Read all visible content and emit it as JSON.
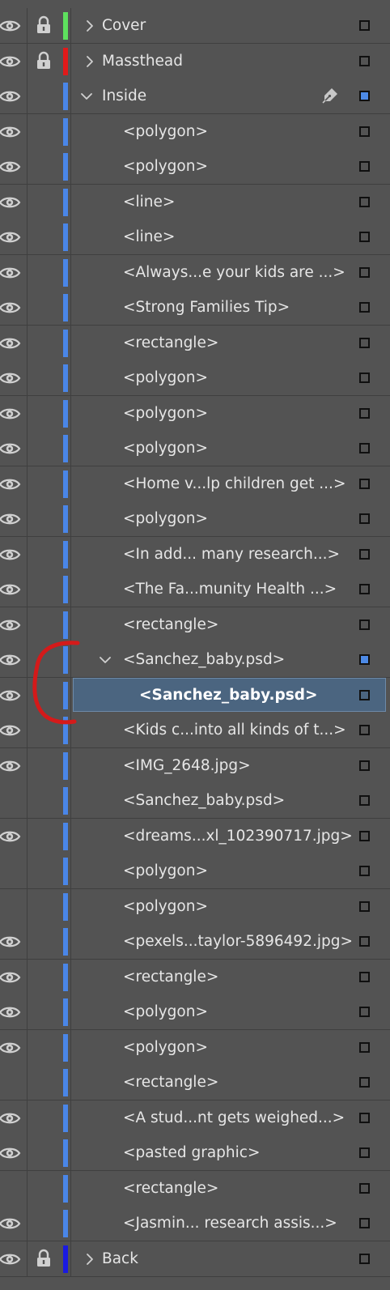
{
  "colors": {
    "panel_bg": "#535353",
    "divider": "#3f3f3f",
    "selected_row": "#4b6580",
    "selection_square": "#4d8ae6",
    "annotation": "#d41a1a"
  },
  "layers": [
    {
      "name": "Cover",
      "type": "layer",
      "depth": 0,
      "expandable": true,
      "expanded": false,
      "visible": true,
      "locked": true,
      "color": "#5ee05e",
      "target_selected": false
    },
    {
      "name": "Massthead",
      "type": "layer",
      "depth": 0,
      "expandable": true,
      "expanded": false,
      "visible": true,
      "locked": true,
      "color": "#e01a1a",
      "target_selected": false
    },
    {
      "name": "Inside",
      "type": "layer",
      "depth": 0,
      "expandable": true,
      "expanded": true,
      "visible": true,
      "locked": false,
      "color": "#4a86e8",
      "target_selected": true,
      "pen": true
    },
    {
      "name": "<polygon>",
      "type": "object",
      "depth": 1,
      "visible": true,
      "locked": false,
      "color": "#4a86e8"
    },
    {
      "name": "<polygon>",
      "type": "object",
      "depth": 1,
      "visible": true,
      "locked": false,
      "color": "#4a86e8"
    },
    {
      "name": "<line>",
      "type": "object",
      "depth": 1,
      "visible": true,
      "locked": false,
      "color": "#4a86e8"
    },
    {
      "name": "<line>",
      "type": "object",
      "depth": 1,
      "visible": true,
      "locked": false,
      "color": "#4a86e8"
    },
    {
      "name": "<Always...e your kids are ...>",
      "type": "object",
      "depth": 1,
      "visible": true,
      "locked": false,
      "color": "#4a86e8"
    },
    {
      "name": "<Strong Families Tip>",
      "type": "object",
      "depth": 1,
      "visible": true,
      "locked": false,
      "color": "#4a86e8"
    },
    {
      "name": "<rectangle>",
      "type": "object",
      "depth": 1,
      "visible": true,
      "locked": false,
      "color": "#4a86e8"
    },
    {
      "name": "<polygon>",
      "type": "object",
      "depth": 1,
      "visible": true,
      "locked": false,
      "color": "#4a86e8"
    },
    {
      "name": "<polygon>",
      "type": "object",
      "depth": 1,
      "visible": true,
      "locked": false,
      "color": "#4a86e8"
    },
    {
      "name": "<polygon>",
      "type": "object",
      "depth": 1,
      "visible": true,
      "locked": false,
      "color": "#4a86e8"
    },
    {
      "name": "<Home v...lp children get ...>",
      "type": "object",
      "depth": 1,
      "visible": true,
      "locked": false,
      "color": "#4a86e8"
    },
    {
      "name": "<polygon>",
      "type": "object",
      "depth": 1,
      "visible": true,
      "locked": false,
      "color": "#4a86e8"
    },
    {
      "name": "<In add... many research...>",
      "type": "object",
      "depth": 1,
      "visible": true,
      "locked": false,
      "color": "#4a86e8"
    },
    {
      "name": "<The Fa...munity Health ...>",
      "type": "object",
      "depth": 1,
      "visible": true,
      "locked": false,
      "color": "#4a86e8"
    },
    {
      "name": "<rectangle>",
      "type": "object",
      "depth": 1,
      "visible": true,
      "locked": false,
      "color": "#4a86e8"
    },
    {
      "name": "<Sanchez_baby.psd>",
      "type": "group",
      "depth": 1,
      "expandable": true,
      "expanded": true,
      "visible": true,
      "locked": false,
      "color": "#4a86e8",
      "target_selected": true
    },
    {
      "name": "<Sanchez_baby.psd>",
      "type": "object",
      "depth": 2,
      "visible": true,
      "locked": false,
      "color": "#4a86e8",
      "selected": true
    },
    {
      "name": "<Kids c...into all kinds of t...>",
      "type": "object",
      "depth": 1,
      "visible": true,
      "locked": false,
      "color": "#4a86e8"
    },
    {
      "name": "<IMG_2648.jpg>",
      "type": "object",
      "depth": 1,
      "visible": true,
      "locked": false,
      "color": "#4a86e8"
    },
    {
      "name": "<Sanchez_baby.psd>",
      "type": "object",
      "depth": 1,
      "visible": false,
      "locked": false,
      "color": "#4a86e8"
    },
    {
      "name": "<dreams...xl_102390717.jpg>",
      "type": "object",
      "depth": 1,
      "visible": true,
      "locked": false,
      "color": "#4a86e8"
    },
    {
      "name": "<polygon>",
      "type": "object",
      "depth": 1,
      "visible": false,
      "locked": false,
      "color": "#4a86e8"
    },
    {
      "name": "<polygon>",
      "type": "object",
      "depth": 1,
      "visible": false,
      "locked": false,
      "color": "#4a86e8"
    },
    {
      "name": "<pexels...taylor-5896492.jpg>",
      "type": "object",
      "depth": 1,
      "visible": true,
      "locked": false,
      "color": "#4a86e8"
    },
    {
      "name": "<rectangle>",
      "type": "object",
      "depth": 1,
      "visible": true,
      "locked": false,
      "color": "#4a86e8"
    },
    {
      "name": "<polygon>",
      "type": "object",
      "depth": 1,
      "visible": true,
      "locked": false,
      "color": "#4a86e8"
    },
    {
      "name": "<polygon>",
      "type": "object",
      "depth": 1,
      "visible": true,
      "locked": false,
      "color": "#4a86e8"
    },
    {
      "name": "<rectangle>",
      "type": "object",
      "depth": 1,
      "visible": false,
      "locked": false,
      "color": "#4a86e8"
    },
    {
      "name": "<A stud...nt gets weighed...>",
      "type": "object",
      "depth": 1,
      "visible": true,
      "locked": false,
      "color": "#4a86e8"
    },
    {
      "name": "<pasted graphic>",
      "type": "object",
      "depth": 1,
      "visible": true,
      "locked": false,
      "color": "#4a86e8"
    },
    {
      "name": "<rectangle>",
      "type": "object",
      "depth": 1,
      "visible": false,
      "locked": false,
      "color": "#4a86e8"
    },
    {
      "name": "<Jasmin... research assis...>",
      "type": "object",
      "depth": 1,
      "visible": true,
      "locked": false,
      "color": "#4a86e8"
    },
    {
      "name": "Back",
      "type": "layer",
      "depth": 0,
      "expandable": true,
      "expanded": false,
      "visible": true,
      "locked": true,
      "color": "#1a1ae0",
      "target_selected": false
    }
  ]
}
